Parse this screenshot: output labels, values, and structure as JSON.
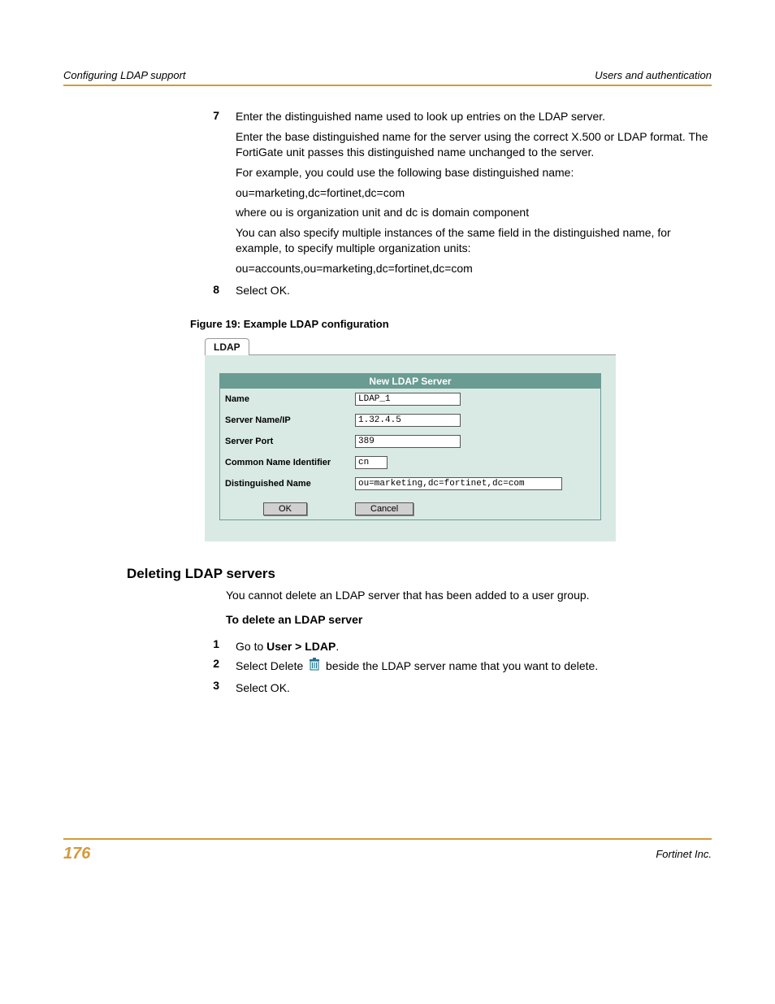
{
  "header": {
    "left": "Configuring LDAP support",
    "right": "Users and authentication"
  },
  "steps_a": [
    {
      "num": "7",
      "paras": [
        "Enter the distinguished name used to look up entries on the LDAP server.",
        "Enter the base distinguished name for the server using the correct X.500 or LDAP format. The FortiGate unit passes this distinguished name unchanged to the server.",
        "For example, you could use the following base distinguished name:",
        "ou=marketing,dc=fortinet,dc=com",
        "where ou is organization unit and dc is domain component",
        "You can also specify multiple instances of the same field in the distinguished name, for example, to specify multiple organization units:",
        "ou=accounts,ou=marketing,dc=fortinet,dc=com"
      ]
    },
    {
      "num": "8",
      "paras": [
        "Select OK."
      ]
    }
  ],
  "figure_caption": "Figure 19: Example LDAP configuration",
  "ldap_tab": "LDAP",
  "ldap_form": {
    "title": "New LDAP Server",
    "rows": [
      {
        "label": "Name",
        "value": "LDAP_1",
        "cls": "short"
      },
      {
        "label": "Server Name/IP",
        "value": "1.32.4.5",
        "cls": "med"
      },
      {
        "label": "Server Port",
        "value": "389",
        "cls": "med"
      },
      {
        "label": "Common Name Identifier",
        "value": "cn",
        "cls": "tiny"
      },
      {
        "label": "Distinguished Name",
        "value": "ou=marketing,dc=fortinet,dc=com",
        "cls": "long"
      }
    ],
    "ok": "OK",
    "cancel": "Cancel"
  },
  "section2_heading": "Deleting LDAP servers",
  "section2_intro": "You cannot delete an LDAP server that has been added to a user group.",
  "delete_heading": "To delete an LDAP server",
  "delete_steps": {
    "s1_num": "1",
    "s1_a": "Go to ",
    "s1_b": "User > LDAP",
    "s1_c": ".",
    "s2_num": "2",
    "s2_a": "Select Delete ",
    "s2_b": " beside the LDAP server name that you want to delete.",
    "s3_num": "3",
    "s3_a": "Select OK."
  },
  "footer": {
    "page": "176",
    "company": "Fortinet Inc."
  }
}
